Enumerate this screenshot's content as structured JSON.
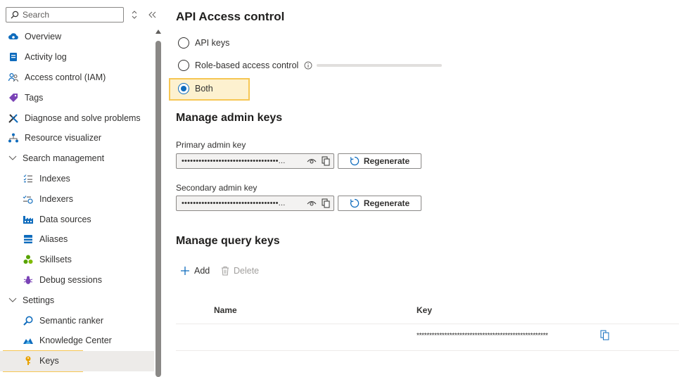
{
  "sidebar": {
    "search_placeholder": "Search",
    "items": [
      {
        "label": "Overview",
        "icon": "cloud-search-icon"
      },
      {
        "label": "Activity log",
        "icon": "activity-log-icon"
      },
      {
        "label": "Access control (IAM)",
        "icon": "people-icon"
      },
      {
        "label": "Tags",
        "icon": "tag-icon"
      },
      {
        "label": "Diagnose and solve problems",
        "icon": "wrench-icon"
      },
      {
        "label": "Resource visualizer",
        "icon": "hierarchy-icon"
      },
      {
        "label": "Search management",
        "icon": "chevron-down-icon"
      },
      {
        "label": "Indexes",
        "icon": "list-icon"
      },
      {
        "label": "Indexers",
        "icon": "indexer-icon"
      },
      {
        "label": "Data sources",
        "icon": "factory-icon"
      },
      {
        "label": "Aliases",
        "icon": "alias-icon"
      },
      {
        "label": "Skillsets",
        "icon": "skillset-icon"
      },
      {
        "label": "Debug sessions",
        "icon": "bug-icon"
      },
      {
        "label": "Settings",
        "icon": "chevron-down-icon"
      },
      {
        "label": "Semantic ranker",
        "icon": "search-icon"
      },
      {
        "label": "Knowledge Center",
        "icon": "knowledge-icon"
      },
      {
        "label": "Keys",
        "icon": "key-icon"
      }
    ]
  },
  "main": {
    "title": "API Access control",
    "radios": [
      {
        "label": "API keys",
        "checked": false
      },
      {
        "label": "Role-based access control",
        "checked": false
      },
      {
        "label": "Both",
        "checked": true
      }
    ],
    "admin_keys": {
      "heading": "Manage admin keys",
      "primary_label": "Primary admin key",
      "primary_value": "••••••••••••••••••••••••••••••••••...",
      "secondary_label": "Secondary admin key",
      "secondary_value": "••••••••••••••••••••••••••••••••••...",
      "regenerate_label": "Regenerate"
    },
    "query_keys": {
      "heading": "Manage query keys",
      "add_label": "Add",
      "delete_label": "Delete",
      "columns": [
        "Name",
        "Key"
      ],
      "rows": [
        {
          "name": "",
          "key": "****************************************************"
        }
      ]
    }
  },
  "colors": {
    "accent": "#0f6cbd",
    "highlight_border": "#f6c653",
    "highlight_fill": "#fdf1cf"
  }
}
